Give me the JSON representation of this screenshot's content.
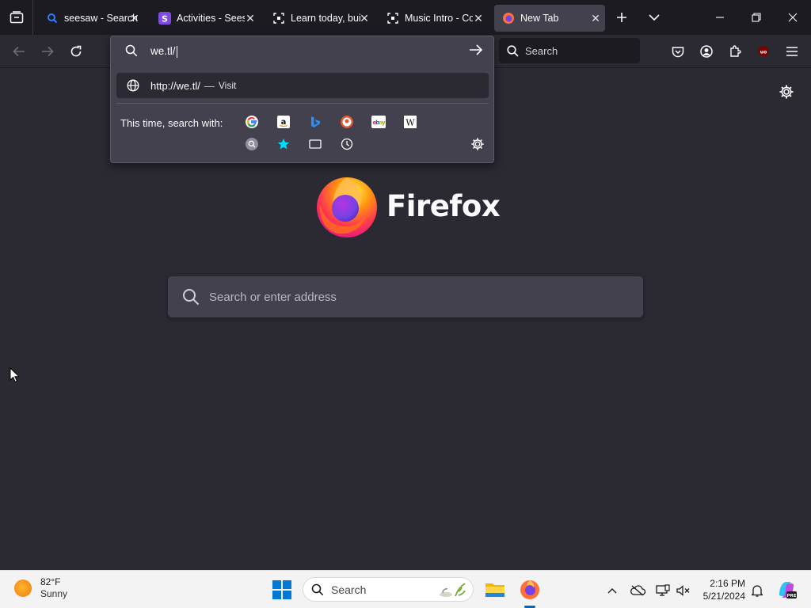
{
  "tabs": [
    {
      "title": "seesaw - Search",
      "favicon": "search-favicon"
    },
    {
      "title": "Activities - Seesaw",
      "favicon": "seesaw-favicon"
    },
    {
      "title": "Learn today, build",
      "favicon": "scan-favicon"
    },
    {
      "title": "Music Intro - Code",
      "favicon": "scan-favicon"
    },
    {
      "title": "New Tab",
      "favicon": "firefox-favicon"
    }
  ],
  "toolbar": {
    "search_placeholder": "Search"
  },
  "urlbar": {
    "value": "we.tl/",
    "result_url": "http://we.tl/",
    "result_separator": "—",
    "result_action": "Visit",
    "oneoff_label": "This time, search with:",
    "engines": [
      "Google",
      "Amazon",
      "Bing",
      "DuckDuckGo",
      "eBay",
      "Wikipedia"
    ],
    "local_sources": [
      "search-engine-icon",
      "bookmarks-icon",
      "tabs-icon",
      "history-icon"
    ]
  },
  "newtab": {
    "brand": "Firefox",
    "search_placeholder": "Search or enter address"
  },
  "taskbar": {
    "weather_temp": "82°F",
    "weather_cond": "Sunny",
    "search_label": "Search",
    "time": "2:16 PM",
    "date": "5/21/2024"
  },
  "colors": {
    "chrome_dark": "#1c1b22",
    "page_bg": "#2b2a33",
    "popup_bg": "#42414d",
    "taskbar_bg": "#f3f3f3",
    "accent": "#0067c0"
  }
}
